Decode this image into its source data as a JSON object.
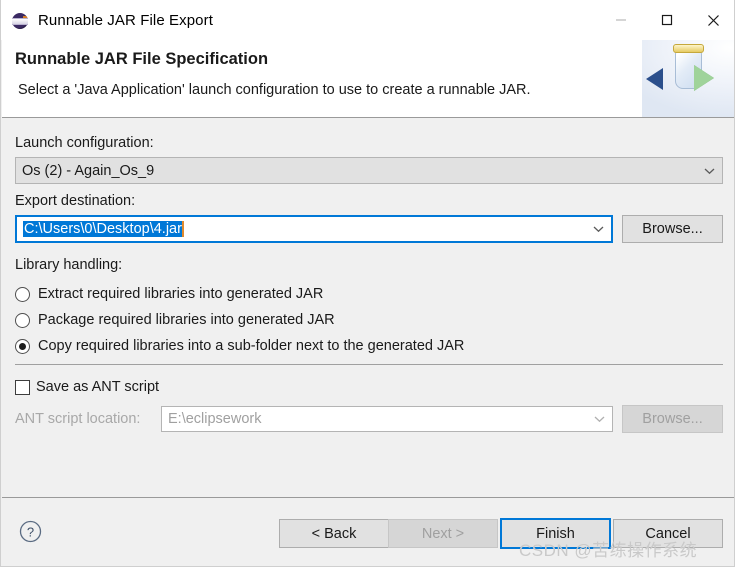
{
  "window": {
    "title": "Runnable JAR File Export",
    "icon": "eclipse-globe-icon",
    "minimize_label": "–",
    "maximize_label": "□",
    "close_label": "✕"
  },
  "header": {
    "title": "Runnable JAR File Specification",
    "description": "Select a 'Java Application' launch configuration to use to create a runnable JAR.",
    "banner_icon": "jar-export-icon"
  },
  "form": {
    "launch_configuration": {
      "label": "Launch configuration:",
      "value": "Os (2) - Again_Os_9",
      "readonly": true
    },
    "export_destination": {
      "label": "Export destination:",
      "value": "C:\\Users\\0\\Desktop\\4.jar",
      "selected": true,
      "browse_label": "Browse..."
    },
    "library_handling": {
      "label": "Library handling:",
      "options": [
        {
          "label": "Extract required libraries into generated JAR",
          "checked": false
        },
        {
          "label": "Package required libraries into generated JAR",
          "checked": false
        },
        {
          "label": "Copy required libraries into a sub-folder next to the generated JAR",
          "checked": true
        }
      ]
    },
    "ant_script": {
      "checkbox_label": "Save as ANT script",
      "checked": false,
      "location_label": "ANT script location:",
      "location_value": "E:\\eclipsework",
      "browse_label": "Browse...",
      "disabled": true
    }
  },
  "footer": {
    "help_icon": "help-question-icon",
    "buttons": {
      "back": {
        "label": "< Back",
        "enabled": true
      },
      "next": {
        "label": "Next >",
        "enabled": false
      },
      "finish": {
        "label": "Finish",
        "enabled": true,
        "default": true
      },
      "cancel": {
        "label": "Cancel",
        "enabled": true
      }
    }
  },
  "watermark": {
    "text": "CSDN @苦练操作系统"
  },
  "colors": {
    "accent": "#0078d7",
    "selection": "#0078d7",
    "cursor": "#e08a2e",
    "dialog_bg": "#f0f0f0",
    "header_bg": "#ffffff"
  }
}
